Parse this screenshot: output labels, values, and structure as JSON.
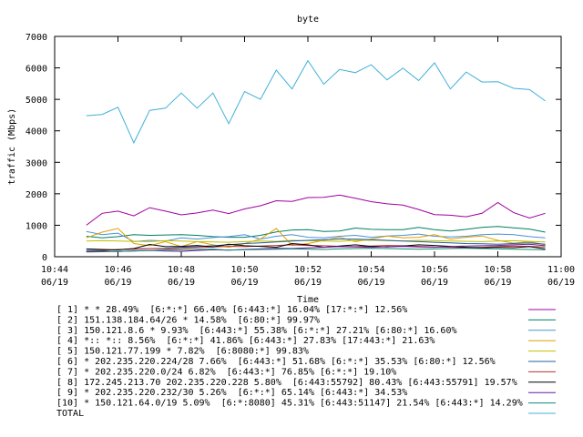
{
  "chart_data": {
    "type": "line",
    "title": "byte",
    "xlabel": "Time",
    "ylabel": "traffic (Mbps)",
    "ylim": [
      0,
      7000
    ],
    "y_ticks": [
      "0",
      "1000",
      "2000",
      "3000",
      "4000",
      "5000",
      "6000",
      "7000"
    ],
    "x_ticks": [
      {
        "time": "10:44",
        "date": "06/19"
      },
      {
        "time": "10:46",
        "date": "06/19"
      },
      {
        "time": "10:48",
        "date": "06/19"
      },
      {
        "time": "10:50",
        "date": "06/19"
      },
      {
        "time": "10:52",
        "date": "06/19"
      },
      {
        "time": "10:54",
        "date": "06/19"
      },
      {
        "time": "10:56",
        "date": "06/19"
      },
      {
        "time": "10:58",
        "date": "06/19"
      },
      {
        "time": "11:00",
        "date": "06/19"
      }
    ],
    "xlim": [
      "10:44",
      "11:00"
    ],
    "x": [
      "10:45:00",
      "10:45:30",
      "10:46:00",
      "10:46:30",
      "10:47:00",
      "10:47:30",
      "10:48:00",
      "10:48:30",
      "10:49:00",
      "10:49:30",
      "10:50:00",
      "10:50:30",
      "10:51:00",
      "10:51:30",
      "10:52:00",
      "10:52:30",
      "10:53:00",
      "10:53:30",
      "10:54:00",
      "10:54:30",
      "10:55:00",
      "10:55:30",
      "10:56:00",
      "10:56:30",
      "10:57:00",
      "10:57:30",
      "10:58:00",
      "10:58:30",
      "10:59:00",
      "10:59:30"
    ],
    "grid": false,
    "legend_position": "bottom",
    "series": [
      {
        "name": "[ 1] * * 28.49%  [6:*:*] 66.40% [6:443:*] 16.04% [17:*:*] 12.56%",
        "color": "#a000a0",
        "values": [
          1000,
          1380,
          1450,
          1300,
          1560,
          1450,
          1330,
          1390,
          1480,
          1370,
          1520,
          1620,
          1780,
          1760,
          1880,
          1890,
          1960,
          1860,
          1750,
          1680,
          1640,
          1500,
          1340,
          1320,
          1270,
          1380,
          1720,
          1400,
          1230,
          1380
        ]
      },
      {
        "name": "[ 2] 151.138.184.64/26 * 14.58%  [6:80:*] 99.97%",
        "color": "#008060",
        "values": [
          650,
          600,
          640,
          700,
          680,
          690,
          700,
          680,
          640,
          620,
          620,
          680,
          790,
          850,
          860,
          800,
          820,
          910,
          870,
          860,
          860,
          930,
          860,
          820,
          870,
          930,
          960,
          920,
          880,
          780
        ]
      },
      {
        "name": "[ 3] 150.121.8.6 * 9.93%  [6:443:*] 55.38% [6:*:*] 27.21% [6:80:*] 16.60%",
        "color": "#4a90d9",
        "values": [
          800,
          700,
          750,
          480,
          520,
          500,
          600,
          560,
          610,
          640,
          700,
          560,
          650,
          700,
          620,
          600,
          650,
          680,
          620,
          660,
          680,
          720,
          650,
          630,
          650,
          700,
          720,
          700,
          640,
          600
        ]
      },
      {
        "name": "[ 4] *:: *:: 8.56%  [6:*:*] 41.86% [6:443:*] 27.83% [17:443:*] 21.63%",
        "color": "#e0a000",
        "values": [
          600,
          780,
          900,
          420,
          350,
          480,
          320,
          480,
          380,
          300,
          420,
          560,
          900,
          360,
          420,
          520,
          620,
          480,
          560,
          660,
          600,
          620,
          700,
          560,
          620,
          660,
          520,
          430,
          480,
          380
        ]
      },
      {
        "name": "[ 5] 150.121.77.199 * 7.82%  [6:8080:*] 99.83%",
        "color": "#c0c000",
        "values": [
          500,
          510,
          500,
          490,
          480,
          510,
          500,
          480,
          470,
          460,
          480,
          500,
          490,
          520,
          510,
          500,
          490,
          520,
          530,
          510,
          500,
          520,
          510,
          500,
          490,
          480,
          500,
          510,
          490,
          470
        ]
      },
      {
        "name": "[ 6] * 202.235.220.224/28 7.66%  [6:443:*] 51.68% [6:*:*] 35.53% [6:80:*] 12.56%",
        "color": "#2060a0",
        "values": [
          200,
          210,
          220,
          250,
          260,
          270,
          300,
          320,
          350,
          380,
          420,
          440,
          470,
          500,
          520,
          540,
          560,
          560,
          540,
          520,
          500,
          480,
          460,
          440,
          420,
          410,
          400,
          420,
          440,
          400
        ]
      },
      {
        "name": "[ 7] * 202.235.220.0/24 6.82%  [6:443:*] 76.85% [6:*:*] 19.10%",
        "color": "#c03030",
        "values": [
          180,
          200,
          230,
          240,
          260,
          250,
          270,
          290,
          310,
          330,
          320,
          340,
          360,
          380,
          360,
          350,
          330,
          320,
          340,
          360,
          350,
          330,
          310,
          300,
          290,
          300,
          320,
          340,
          330,
          310
        ]
      },
      {
        "name": "[ 8] 172.245.213.70 202.235.220.228 5.80%  [6:443:55792] 80.43% [6:443:55791] 19.57%",
        "color": "#000000",
        "values": [
          250,
          230,
          220,
          260,
          390,
          320,
          330,
          360,
          310,
          400,
          350,
          330,
          300,
          420,
          380,
          300,
          340,
          380,
          330,
          310,
          340,
          380,
          360,
          330,
          300,
          280,
          300,
          290,
          320,
          250
        ]
      },
      {
        "name": "[ 9] * 202.235.220.232/30 5.26%  [6:*:*] 65.14% [6:443:*] 34.53%",
        "color": "#6a1a9a",
        "values": [
          150,
          160,
          170,
          180,
          200,
          180,
          170,
          200,
          220,
          210,
          230,
          250,
          270,
          260,
          280,
          300,
          320,
          310,
          300,
          320,
          330,
          310,
          300,
          320,
          340,
          350,
          360,
          380,
          400,
          350
        ]
      },
      {
        "name": "[10] * 150.121.64.0/19 5.09%  [6:*:8080] 45.31% [6:443:51147] 21.54% [6:443:*] 14.29%",
        "color": "#108a70",
        "values": [
          170,
          180,
          160,
          190,
          200,
          210,
          220,
          230,
          240,
          210,
          220,
          230,
          240,
          250,
          240,
          230,
          250,
          260,
          270,
          260,
          250,
          240,
          250,
          260,
          270,
          260,
          250,
          240,
          230,
          220
        ]
      },
      {
        "name": "TOTAL",
        "color": "#40b0d8",
        "values": [
          4480,
          4520,
          4750,
          3620,
          4650,
          4720,
          5200,
          4720,
          5200,
          4230,
          5250,
          5000,
          5930,
          5330,
          6230,
          5480,
          5950,
          5850,
          6100,
          5620,
          5990,
          5600,
          6160,
          5330,
          5870,
          5550,
          5560,
          5350,
          5310,
          4950
        ]
      }
    ]
  }
}
